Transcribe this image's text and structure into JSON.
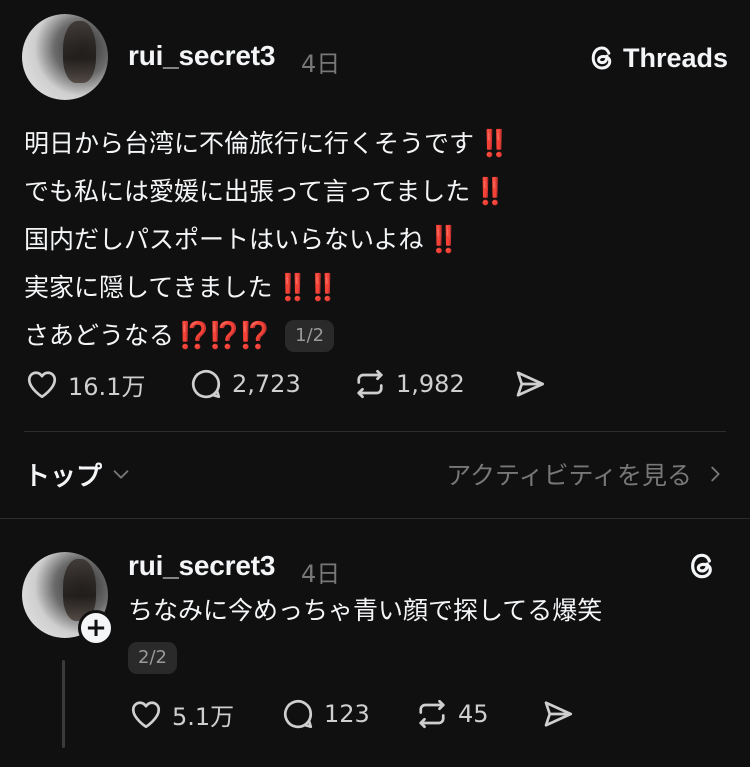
{
  "app": {
    "brand_name": "Threads"
  },
  "post": {
    "username": "rui_secret3",
    "time_ago": "4日",
    "lines": [
      {
        "text": "明日から台湾に不倫旅行に行くそうです",
        "emoji": "‼️"
      },
      {
        "text": "でも私には愛媛に出張って言ってました",
        "emoji": "‼️"
      },
      {
        "text": "国内だしパスポートはいらないよね",
        "emoji": "‼️"
      },
      {
        "text": "実家に隠してきました",
        "emoji": "‼️‼️"
      },
      {
        "text": "さあどうなる",
        "emoji": "⁉️⁉️⁉️"
      }
    ],
    "pager": "1/2",
    "likes": "16.1万",
    "replies": "2,723",
    "reposts": "1,982"
  },
  "sort_bar": {
    "label": "トップ",
    "activity_link": "アクティビティを見る"
  },
  "reply": {
    "username": "rui_secret3",
    "time_ago": "4日",
    "text": "ちなみに今めっちゃ青い顔で探してる爆笑",
    "pager": "2/2",
    "likes": "5.1万",
    "replies": "123",
    "reposts": "45"
  },
  "icons": {
    "like": "heart-icon",
    "reply": "comment-icon",
    "repost": "repost-icon",
    "share": "send-icon",
    "brand": "threads-logo-icon",
    "sort": "chevron-down-icon",
    "activity": "chevron-right-icon",
    "follow": "plus-icon"
  },
  "colors": {
    "background": "#101010",
    "text": "#f3f5f7",
    "muted": "#777777",
    "emoji_red": "#e0241b"
  }
}
